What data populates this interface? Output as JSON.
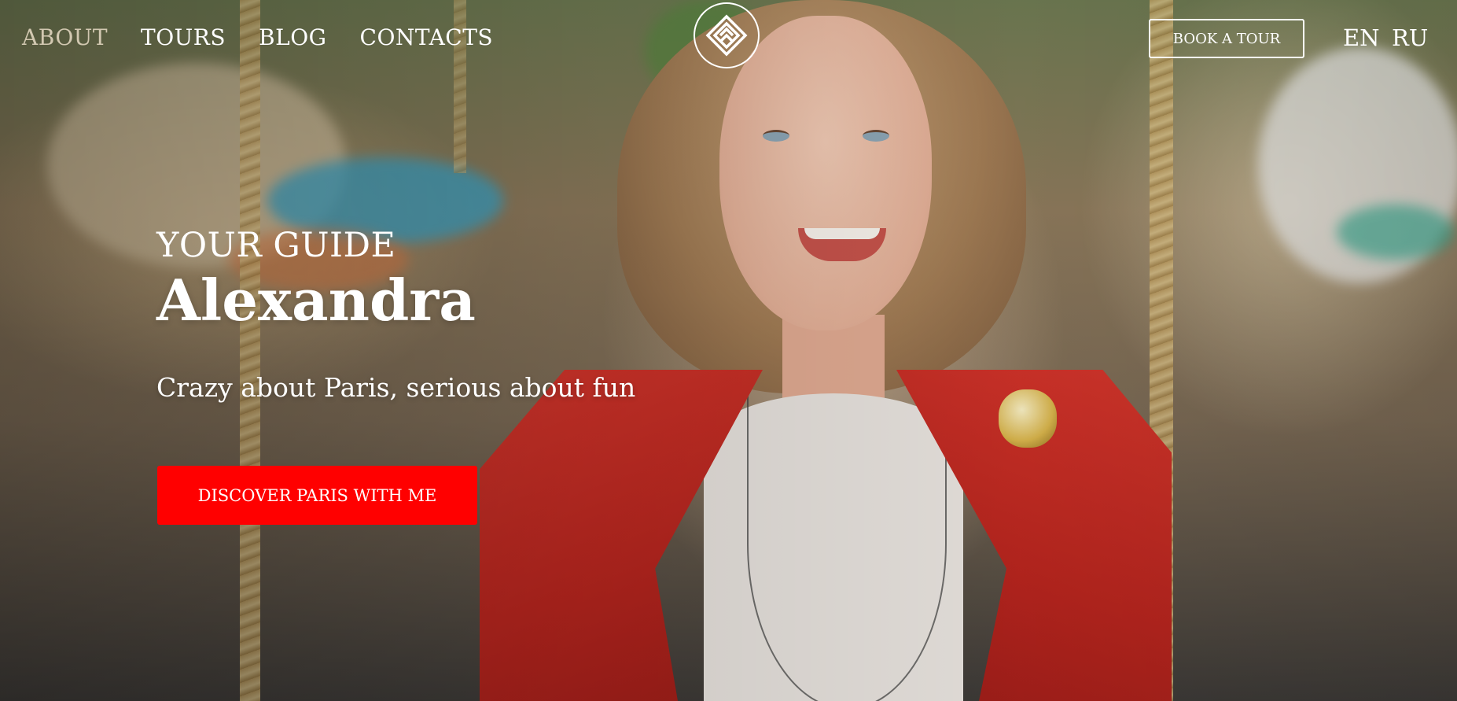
{
  "nav": {
    "links": [
      {
        "label": "ABOUT"
      },
      {
        "label": "TOURS"
      },
      {
        "label": "BLOG"
      },
      {
        "label": "CONTACTS"
      }
    ],
    "logo_icon": "diamond-logo-icon",
    "book_label": "BOOK A TOUR",
    "languages": [
      "EN",
      "RU"
    ]
  },
  "hero": {
    "subtitle": "YOUR GUIDE",
    "title": "Alexandra",
    "tagline": "Crazy about Paris, serious about fun",
    "cta_label": "DISCOVER PARIS WITH ME",
    "colors": {
      "cta": "#ff0000",
      "text": "#ffffff"
    }
  }
}
